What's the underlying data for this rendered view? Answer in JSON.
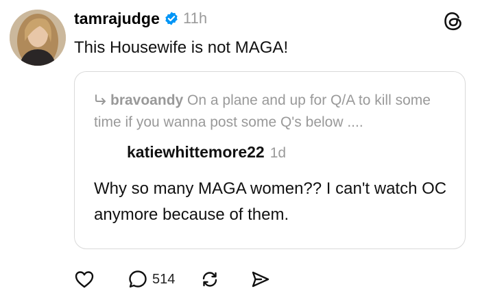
{
  "post": {
    "username": "tamrajudge",
    "time": "11h",
    "text": "This Housewife is not MAGA!"
  },
  "quote": {
    "parent_user": "bravoandy",
    "parent_text": "On a plane and up for Q/A to kill some time if you wanna post some Q's below ....",
    "author": "katiewhittemore22",
    "time": "1d",
    "text": "Why so many MAGA women?? I can't watch OC anymore because of them."
  },
  "actions": {
    "reply_count": "514"
  },
  "icons": [
    "verified-badge-icon",
    "threads-logo-icon",
    "reply-arrow-icon",
    "heart-icon",
    "comment-icon",
    "repost-icon",
    "share-icon"
  ],
  "colors": {
    "verified": "#0095f6",
    "muted": "#9a9a9a",
    "border": "#d9d9d9"
  }
}
